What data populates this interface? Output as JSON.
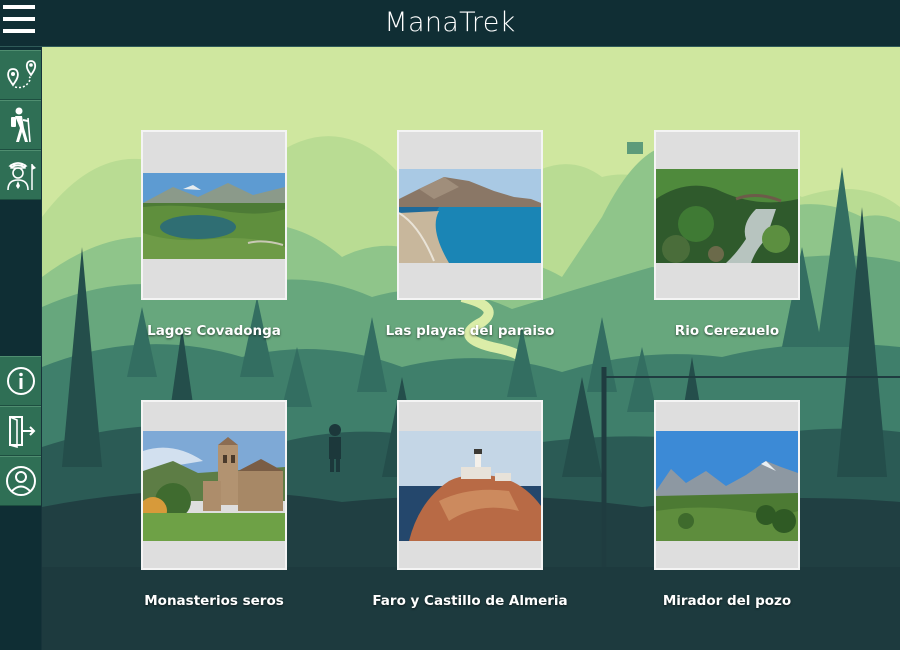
{
  "app": {
    "title": "ManaTrek"
  },
  "header": {
    "menu_icon": "hamburger-menu-icon"
  },
  "sidebar": {
    "top_items": [
      {
        "name": "route-map",
        "icon": "route-pins-icon"
      },
      {
        "name": "hiking",
        "icon": "hiker-icon"
      },
      {
        "name": "guide",
        "icon": "guide-person-icon"
      }
    ],
    "bottom_items": [
      {
        "name": "info",
        "icon": "info-icon"
      },
      {
        "name": "logout",
        "icon": "exit-door-icon"
      },
      {
        "name": "profile",
        "icon": "user-profile-icon"
      }
    ]
  },
  "places": [
    {
      "label": "Lagos Covadonga"
    },
    {
      "label": "Las playas del paraiso"
    },
    {
      "label": "Rio Cerezuelo"
    },
    {
      "label": "Monasterios seros"
    },
    {
      "label": "Faro y Castillo de Almeria"
    },
    {
      "label": "Mirador del pozo"
    }
  ],
  "colors": {
    "header_bg": "#102e34",
    "sidebar_button": "#2f6f55",
    "sky": "#cfe79f",
    "forest_dark": "#1f3c40"
  }
}
